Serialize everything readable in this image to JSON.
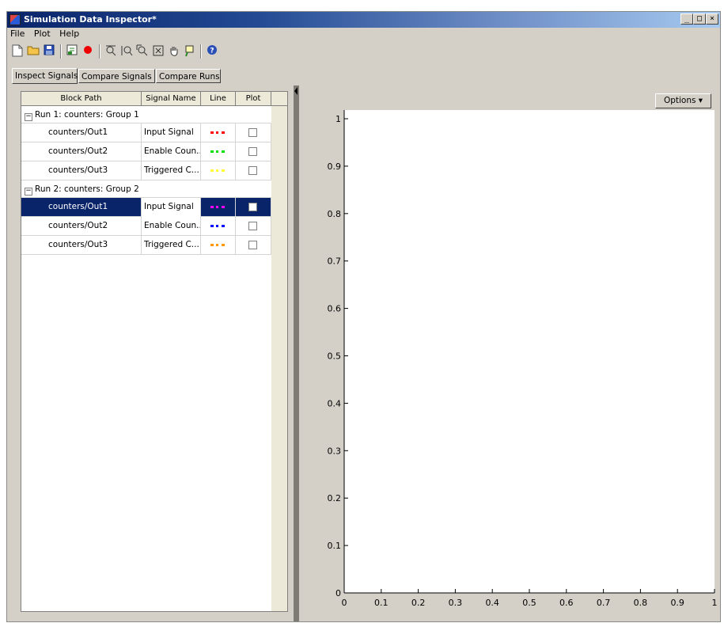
{
  "window": {
    "title": "Simulation Data Inspector*",
    "title_buttons": [
      "_",
      "□",
      "×"
    ]
  },
  "menu": [
    "File",
    "Plot",
    "Help"
  ],
  "toolbar": {
    "icons": [
      "new-file-icon",
      "open-folder-icon",
      "save-icon",
      "import-icon",
      "record-icon",
      "zoom-x-icon",
      "zoom-y-icon",
      "zoom-in-icon",
      "fit-to-view-icon",
      "pan-hand-icon",
      "data-cursor-icon",
      "help-icon"
    ]
  },
  "tabs": [
    "Inspect Signals",
    "Compare Signals",
    "Compare Runs"
  ],
  "table": {
    "headers": [
      "Block Path",
      "Signal Name",
      "Line",
      "Plot"
    ],
    "groups": [
      {
        "label": "Run 1: counters: Group 1",
        "rows": [
          {
            "path": "counters/Out1",
            "signal": "Input Signal",
            "color": "#ff0000",
            "checked": false
          },
          {
            "path": "counters/Out2",
            "signal": "Enable Coun...",
            "color": "#00dd00",
            "checked": false
          },
          {
            "path": "counters/Out3",
            "signal": "Triggered C...",
            "color": "#ffff33",
            "checked": false
          }
        ]
      },
      {
        "label": "Run 2: counters: Group 2",
        "rows": [
          {
            "path": "counters/Out1",
            "signal": "Input Signal",
            "color": "#ff00ff",
            "checked": false,
            "selected": true
          },
          {
            "path": "counters/Out2",
            "signal": "Enable Coun...",
            "color": "#0000ff",
            "checked": false
          },
          {
            "path": "counters/Out3",
            "signal": "Triggered C...",
            "color": "#ff9900",
            "checked": false
          }
        ]
      }
    ]
  },
  "options_button": "Options ▾",
  "plot": {
    "y_ticks": [
      "0",
      "0.1",
      "0.2",
      "0.3",
      "0.4",
      "0.5",
      "0.6",
      "0.7",
      "0.8",
      "0.9",
      "1"
    ],
    "x_ticks": [
      "0",
      "0.1",
      "0.2",
      "0.3",
      "0.4",
      "0.5",
      "0.6",
      "0.7",
      "0.8",
      "0.9",
      "1"
    ]
  }
}
